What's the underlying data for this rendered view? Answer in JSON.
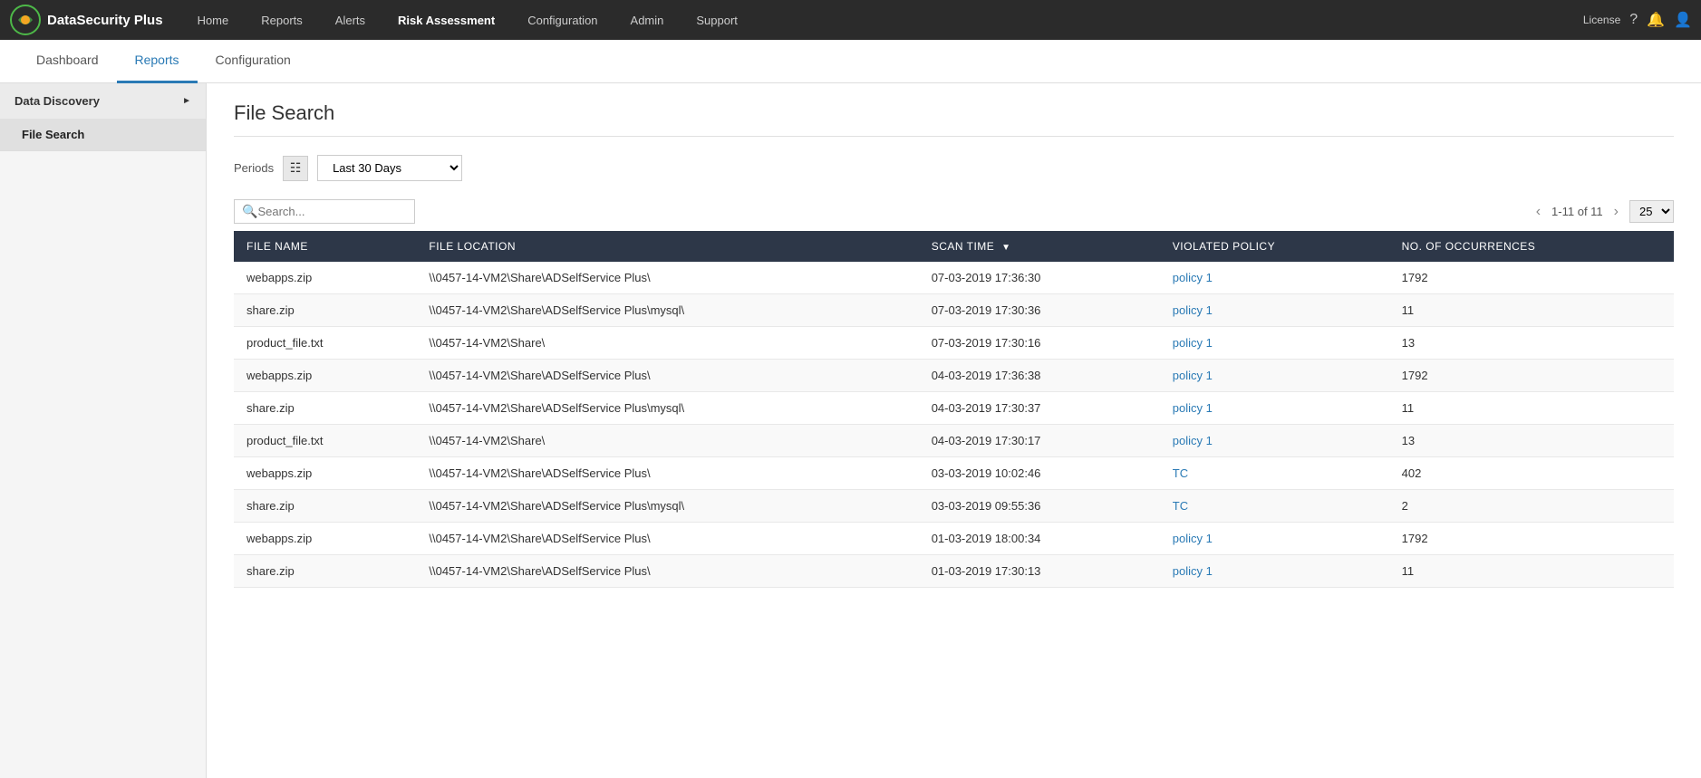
{
  "brand": {
    "name": "DataSecurity Plus"
  },
  "top_nav": {
    "items": [
      {
        "label": "Home",
        "active": false
      },
      {
        "label": "Reports",
        "active": false
      },
      {
        "label": "Alerts",
        "active": false
      },
      {
        "label": "Risk Assessment",
        "active": true
      },
      {
        "label": "Configuration",
        "active": false
      },
      {
        "label": "Admin",
        "active": false
      },
      {
        "label": "Support",
        "active": false
      }
    ],
    "license_label": "License"
  },
  "sub_nav": {
    "items": [
      {
        "label": "Dashboard",
        "active": false
      },
      {
        "label": "Reports",
        "active": true
      },
      {
        "label": "Configuration",
        "active": false
      }
    ]
  },
  "sidebar": {
    "groups": [
      {
        "label": "Data Discovery",
        "items": [
          {
            "label": "File Search",
            "active": true
          }
        ]
      }
    ]
  },
  "main": {
    "page_title": "File Search",
    "periods_label": "Periods",
    "periods_value": "Last 30 Days"
  },
  "table": {
    "search_placeholder": "Search...",
    "pagination": "1-11 of 11",
    "page_size": "25",
    "columns": [
      {
        "label": "FILE NAME",
        "sortable": false
      },
      {
        "label": "FILE LOCATION",
        "sortable": false
      },
      {
        "label": "SCAN TIME",
        "sortable": true
      },
      {
        "label": "VIOLATED POLICY",
        "sortable": false
      },
      {
        "label": "NO. OF OCCURRENCES",
        "sortable": false
      }
    ],
    "rows": [
      {
        "file_name": "webapps.zip",
        "file_location": "\\\\0457-14-VM2\\Share\\ADSelfService Plus\\",
        "scan_time": "07-03-2019 17:36:30",
        "violated_policy": "policy 1",
        "occurrences": "1792"
      },
      {
        "file_name": "share.zip",
        "file_location": "\\\\0457-14-VM2\\Share\\ADSelfService Plus\\mysql\\",
        "scan_time": "07-03-2019 17:30:36",
        "violated_policy": "policy 1",
        "occurrences": "11"
      },
      {
        "file_name": "product_file.txt",
        "file_location": "\\\\0457-14-VM2\\Share\\",
        "scan_time": "07-03-2019 17:30:16",
        "violated_policy": "policy 1",
        "occurrences": "13"
      },
      {
        "file_name": "webapps.zip",
        "file_location": "\\\\0457-14-VM2\\Share\\ADSelfService Plus\\",
        "scan_time": "04-03-2019 17:36:38",
        "violated_policy": "policy 1",
        "occurrences": "1792"
      },
      {
        "file_name": "share.zip",
        "file_location": "\\\\0457-14-VM2\\Share\\ADSelfService Plus\\mysql\\",
        "scan_time": "04-03-2019 17:30:37",
        "violated_policy": "policy 1",
        "occurrences": "11"
      },
      {
        "file_name": "product_file.txt",
        "file_location": "\\\\0457-14-VM2\\Share\\",
        "scan_time": "04-03-2019 17:30:17",
        "violated_policy": "policy 1",
        "occurrences": "13"
      },
      {
        "file_name": "webapps.zip",
        "file_location": "\\\\0457-14-VM2\\Share\\ADSelfService Plus\\",
        "scan_time": "03-03-2019 10:02:46",
        "violated_policy": "TC",
        "occurrences": "402"
      },
      {
        "file_name": "share.zip",
        "file_location": "\\\\0457-14-VM2\\Share\\ADSelfService Plus\\mysql\\",
        "scan_time": "03-03-2019 09:55:36",
        "violated_policy": "TC",
        "occurrences": "2"
      },
      {
        "file_name": "webapps.zip",
        "file_location": "\\\\0457-14-VM2\\Share\\ADSelfService Plus\\",
        "scan_time": "01-03-2019 18:00:34",
        "violated_policy": "policy 1",
        "occurrences": "1792"
      },
      {
        "file_name": "share.zip",
        "file_location": "\\\\0457-14-VM2\\Share\\ADSelfService Plus\\",
        "scan_time": "01-03-2019 17:30:13",
        "violated_policy": "policy 1",
        "occurrences": "11"
      }
    ]
  }
}
